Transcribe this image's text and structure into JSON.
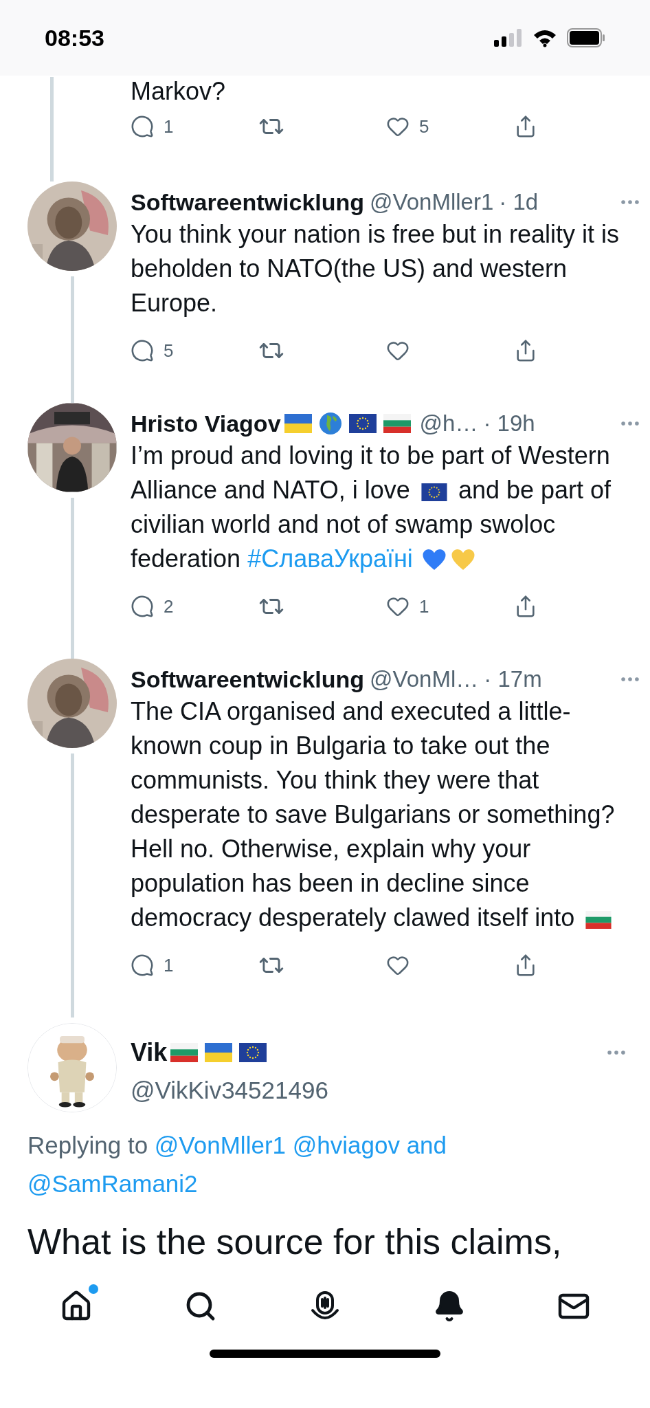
{
  "status_bar": {
    "time": "08:53"
  },
  "thread": [
    {
      "kind": "partial",
      "tail": "Markov?",
      "actions": {
        "reply": "1",
        "like": "5"
      }
    },
    {
      "kind": "tweet",
      "name": "Softwareentwicklung",
      "handle": "@VonMller1",
      "time": "· 1d",
      "body": [
        {
          "kind": "text",
          "text": "You think your nation is free but in reality it is beholden to NATO(the US) and western Europe."
        }
      ],
      "actions": {
        "reply": "5"
      }
    },
    {
      "kind": "tweet",
      "name": "Hristo Viagov",
      "flags": [
        {
          "kind": "ua"
        },
        {
          "kind": "globe"
        },
        {
          "kind": "eu"
        },
        {
          "kind": "bg"
        }
      ],
      "handle": "@h…",
      "time": "· 19h",
      "body": [
        {
          "kind": "text",
          "text": "I’m proud and loving it to be part of Western Alliance and NATO, i love"
        },
        {
          "kind": "eu"
        },
        {
          "kind": "text",
          "text": "and be part of civilian world and not of swamp swoloc federation"
        },
        {
          "kind": "hashtag",
          "text": "#СлаваУкраїні"
        },
        {
          "kind": "heart",
          "color": "#2f7cf6"
        },
        {
          "kind": "heart",
          "color": "#f7c948"
        }
      ],
      "actions": {
        "reply": "2",
        "like": "1"
      }
    },
    {
      "kind": "tweet",
      "name": "Softwareentwicklung",
      "handle": "@VonMl…",
      "time": "· 17m",
      "body": [
        {
          "kind": "text",
          "text": "The CIA organised and executed a little-known coup in Bulgaria to take out the communists. You think they were that desperate to save Bulgarians or something? Hell no. Otherwise, explain why your population has been in decline since democracy desperately clawed itself into"
        },
        {
          "kind": "bg"
        }
      ],
      "actions": {
        "reply": "1"
      }
    }
  ],
  "main_tweet": {
    "name": "Vik",
    "flags": [
      {
        "kind": "bg"
      },
      {
        "kind": "ua"
      },
      {
        "kind": "eu"
      }
    ],
    "handle": "@VikKiv34521496",
    "replying": [
      {
        "kind": "plain",
        "text": "Replying to"
      },
      {
        "kind": "link",
        "text": "@VonMller1"
      },
      {
        "kind": "link",
        "text": "@hviagov"
      },
      {
        "kind": "link",
        "text": "and"
      },
      {
        "kind": "link",
        "text": "@SamRamani2"
      }
    ],
    "body": "What is the source for this claims,"
  },
  "tab_bar": [
    {
      "kind": "home",
      "badge": true
    },
    {
      "kind": "search",
      "badge": false
    },
    {
      "kind": "spaces",
      "badge": false
    },
    {
      "kind": "notifications",
      "badge": false
    },
    {
      "kind": "messages",
      "badge": false
    }
  ]
}
